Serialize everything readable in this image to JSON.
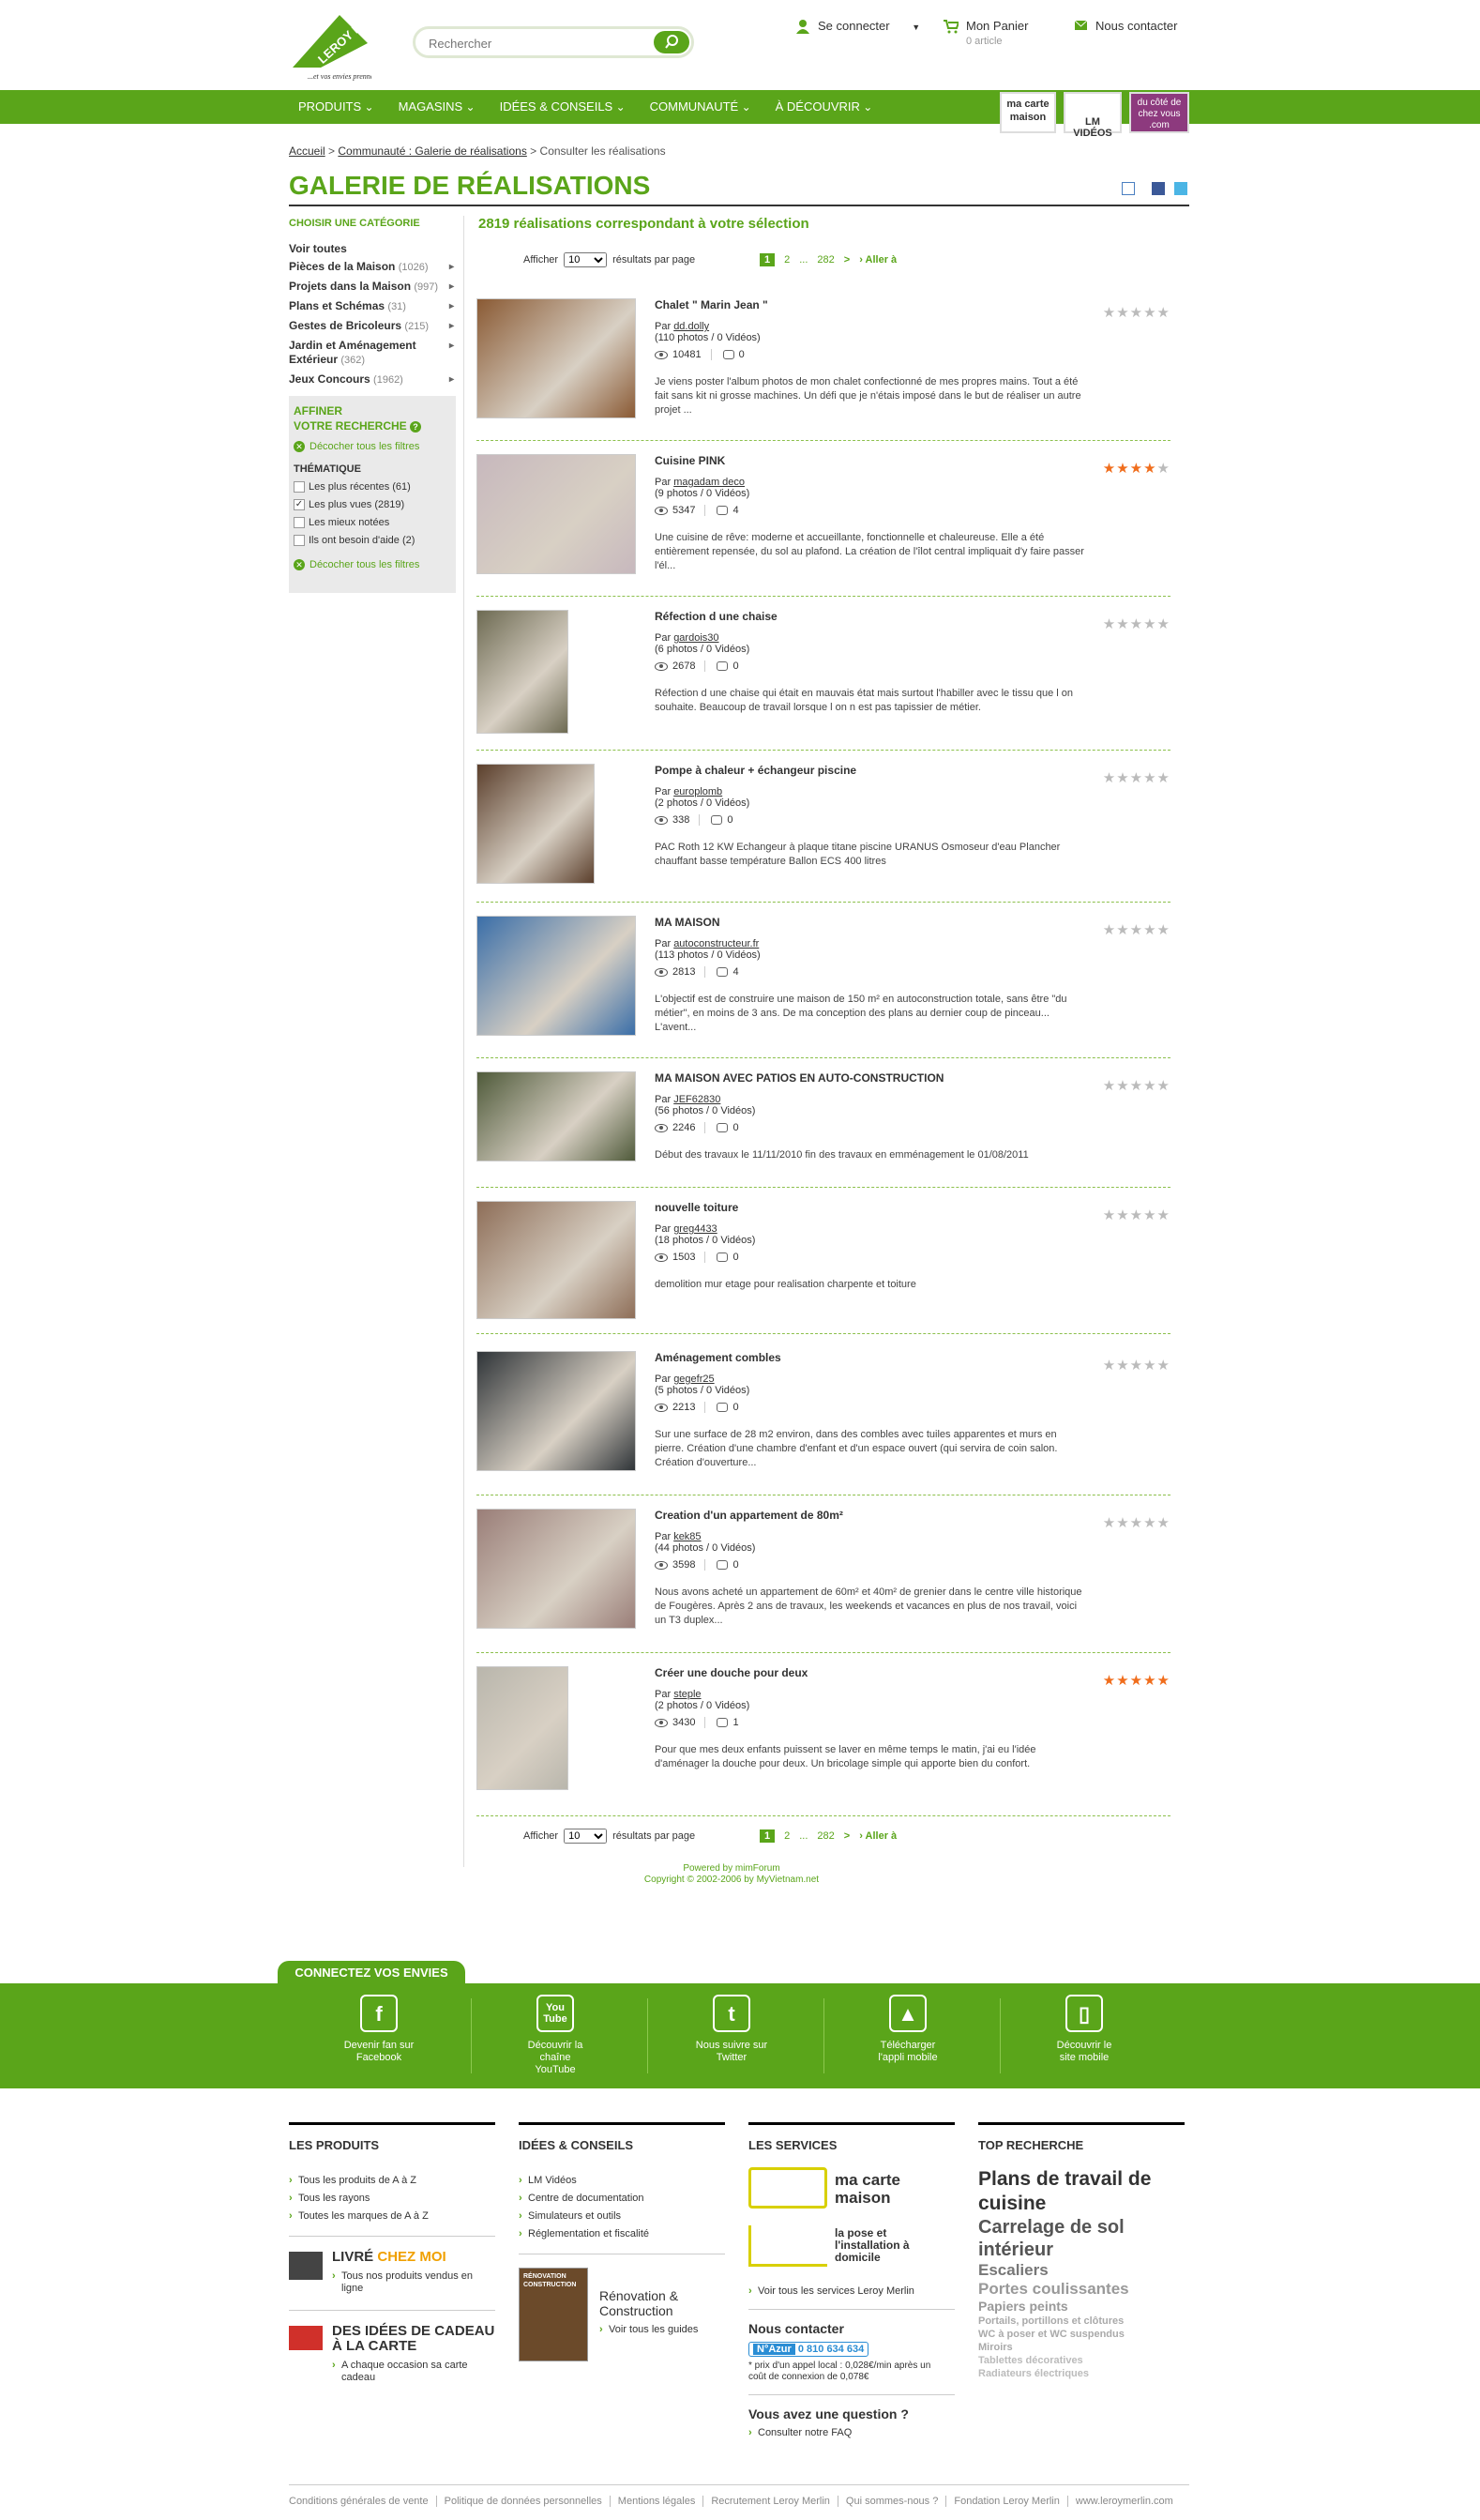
{
  "header": {
    "logo_text": "LEROY MERLIN",
    "logo_slogan": "...et vos envies prennent Vie !",
    "search_placeholder": "Rechercher",
    "login": "Se connecter",
    "cart": "Mon Panier",
    "cart_count": "0 article",
    "contact": "Nous contacter"
  },
  "nav": {
    "items": [
      "PRODUITS",
      "MAGASINS",
      "IDÉES & CONSEILS",
      "COMMUNAUTÉ",
      "À DÉCOUVRIR"
    ],
    "badges": [
      "ma carte maison",
      "LM VIDÉOS",
      "du côté de chez vous .com"
    ]
  },
  "breadcrumb": {
    "home": "Accueil",
    "section": "Communauté : Galerie de réalisations",
    "current": "Consulter les réalisations",
    "sep": ">"
  },
  "page_title": "GALERIE DE RÉALISATIONS",
  "sidebar": {
    "heading": "CHOISIR UNE CATÉGORIE",
    "all": "Voir toutes",
    "categories": [
      {
        "label": "Pièces de la Maison",
        "count": "(1026)"
      },
      {
        "label": "Projets dans la Maison",
        "count": "(997)"
      },
      {
        "label": "Plans et Schémas",
        "count": "(31)"
      },
      {
        "label": "Gestes de Bricoleurs",
        "count": "(215)"
      },
      {
        "label": "Jardin et Aménagement Extérieur",
        "count": "(362)"
      },
      {
        "label": "Jeux Concours",
        "count": "(1962)"
      }
    ],
    "refine_title_1": "AFFINER",
    "refine_title_2": "VOTRE RECHERCHE",
    "uncheck_all": "Décocher tous les filtres",
    "thematique": "THÉMATIQUE",
    "filters": [
      {
        "label": "Les plus récentes (61)",
        "checked": false
      },
      {
        "label": "Les plus vues (2819)",
        "checked": true
      },
      {
        "label": "Les mieux notées",
        "checked": false
      },
      {
        "label": "Ils ont besoin d'aide (2)",
        "checked": false
      }
    ]
  },
  "results": {
    "count_text": "2819 réalisations correspondant à votre sélection",
    "show_label": "Afficher",
    "per_page": "10",
    "per_page_suffix": "résultats par page",
    "pages": [
      "1",
      "2",
      "...",
      "282"
    ],
    "next": ">",
    "goto": "› Aller à"
  },
  "items": [
    {
      "title": "Chalet \" Marin Jean \"",
      "by": "Par",
      "author": "dd.dolly",
      "photos": "(110 photos / 0 Vidéos)",
      "views": "10481",
      "comments": "0",
      "rating": 0,
      "desc": "Je viens poster l'album photos de mon chalet confectionné de mes propres mains. Tout a été fait sans kit ni grosse machines. Un défi que je n'étais imposé dans le but de réaliser un autre projet ..."
    },
    {
      "title": "Cuisine PINK",
      "by": "Par",
      "author": "magadam deco",
      "photos": "(9 photos / 0 Vidéos)",
      "views": "5347",
      "comments": "4",
      "rating": 3.5,
      "desc": "Une cuisine de rêve: moderne et accueillante, fonctionnelle et chaleureuse. Elle a été entièrement repensée, du sol au plafond. La création de l'îlot central impliquait d'y faire passer l'él..."
    },
    {
      "title": "Réfection d une chaise",
      "by": "Par",
      "author": "gardois30",
      "photos": "(6 photos / 0 Vidéos)",
      "views": "2678",
      "comments": "0",
      "rating": 0,
      "desc": "Réfection d une chaise qui était en mauvais état mais surtout l'habiller avec le tissu que l on souhaite. Beaucoup de travail lorsque l on n est pas tapissier de métier."
    },
    {
      "title": "Pompe à chaleur + échangeur piscine",
      "by": "Par",
      "author": "europlomb",
      "photos": "(2 photos / 0 Vidéos)",
      "views": "338",
      "comments": "0",
      "rating": 0,
      "desc": "PAC Roth 12 KW Echangeur à plaque titane piscine URANUS Osmoseur d'eau Plancher chauffant basse température Ballon ECS 400 litres"
    },
    {
      "title": "MA MAISON",
      "by": "Par",
      "author": "autoconstructeur.fr",
      "photos": "(113 photos / 0 Vidéos)",
      "views": "2813",
      "comments": "4",
      "rating": 0,
      "desc": "L'objectif est de construire une maison de 150 m² en autoconstruction totale, sans être \"du métier\", en moins de 3 ans. De ma conception des plans au dernier coup de pinceau... L'avent..."
    },
    {
      "title": "MA MAISON AVEC PATIOS EN AUTO-CONSTRUCTION",
      "by": "Par",
      "author": "JEF62830",
      "photos": "(56 photos / 0 Vidéos)",
      "views": "2246",
      "comments": "0",
      "rating": 0,
      "desc": "Début des travaux le 11/11/2010 fin des travaux en emménagement le 01/08/2011"
    },
    {
      "title": "nouvelle toiture",
      "by": "Par",
      "author": "greg4433",
      "photos": "(18 photos / 0 Vidéos)",
      "views": "1503",
      "comments": "0",
      "rating": 0,
      "desc": "demolition mur etage pour realisation charpente et toiture"
    },
    {
      "title": "Aménagement combles",
      "by": "Par",
      "author": "gegefr25",
      "photos": "(5 photos / 0 Vidéos)",
      "views": "2213",
      "comments": "0",
      "rating": 0,
      "desc": "Sur une surface de 28 m2 environ, dans des combles avec tuiles apparentes et murs en pierre. Création d'une chambre d'enfant et d'un espace ouvert (qui servira de coin salon. Création d'ouverture..."
    },
    {
      "title": "Creation d'un appartement de 80m²",
      "by": "Par",
      "author": "kek85",
      "photos": "(44 photos / 0 Vidéos)",
      "views": "3598",
      "comments": "0",
      "rating": 0,
      "desc": "Nous avons acheté un appartement de 60m² et 40m² de grenier dans le centre ville historique de Fougères. Après 2 ans de travaux, les weekends et vacances en plus de nos travail, voici un T3 duplex..."
    },
    {
      "title": "Créer une douche pour deux",
      "by": "Par",
      "author": "steple",
      "photos": "(2 photos / 0 Vidéos)",
      "views": "3430",
      "comments": "1",
      "rating": 5,
      "desc": "Pour que mes deux enfants puissent se laver en même temps le matin, j'ai eu l'idée d'aménager la douche pour deux. Un bricolage simple qui apporte bien du confort."
    }
  ],
  "powered": {
    "line1": "Powered by mimForum",
    "line2": "Copyright © 2002-2006 by MyVietnam.net"
  },
  "connect": {
    "title": "CONNECTEZ VOS ENVIES",
    "items": [
      {
        "icon": "facebook-icon",
        "glyph": "f",
        "l1": "Devenir fan sur",
        "l2": "Facebook",
        "l3": ""
      },
      {
        "icon": "youtube-icon",
        "glyph": "You Tube",
        "l1": "Découvrir la",
        "l2": "chaîne",
        "l3": "YouTube"
      },
      {
        "icon": "twitter-icon",
        "glyph": "t",
        "l1": "Nous suivre sur",
        "l2": "Twitter",
        "l3": ""
      },
      {
        "icon": "app-icon",
        "glyph": "▲",
        "l1": "Télécharger",
        "l2": "l'appli mobile",
        "l3": ""
      },
      {
        "icon": "mobile-icon",
        "glyph": "▯",
        "l1": "Découvrir le",
        "l2": "site mobile",
        "l3": ""
      }
    ]
  },
  "footer": {
    "produits": {
      "title": "LES PRODUITS",
      "links": [
        "Tous les produits de A à Z",
        "Tous les rayons",
        "Toutes les marques de A à Z"
      ],
      "livre_1": "LIVRÉ",
      "livre_2": "CHEZ MOI",
      "livre_link": "Tous nos produits vendus en ligne",
      "cadeau": "DES IDÉES DE CADEAU À LA CARTE",
      "cadeau_link": "A chaque occasion sa carte cadeau"
    },
    "idees": {
      "title": "IDÉES & CONSEILS",
      "links": [
        "LM Vidéos",
        "Centre de documentation",
        "Simulateurs et outils",
        "Réglementation et fiscalité"
      ],
      "reno": "Rénovation & Construction",
      "reno_link": "Voir tous les guides",
      "book_label": "RÉNOVATION CONSTRUCTION"
    },
    "services": {
      "title": "LES SERVICES",
      "carte": "ma carte maison",
      "pose": "la pose et l'installation à domicile",
      "all": "Voir tous les services Leroy Merlin",
      "contact": "Nous contacter",
      "azur_label": "N°Azur",
      "azur": "0 810 634 634",
      "price": "* prix d'un appel local : 0,028€/min après un coût de connexion de 0,078€",
      "question": "Vous avez une question ?",
      "faq": "Consulter notre FAQ"
    },
    "top": {
      "title": "TOP RECHERCHE",
      "t1": "Plans de travail de cuisine",
      "t2": "Carrelage de sol intérieur",
      "t3": "Escaliers",
      "t4": "Portes coulissantes",
      "t5": "Papiers peints",
      "t6": "Portails, portillons et clôtures",
      "t7": "WC à poser et WC suspendus",
      "t8": "Miroirs",
      "t9": "Tablettes décoratives",
      "t10": "Radiateurs électriques"
    },
    "legal": [
      "Conditions générales de vente",
      "Politique de données personnelles",
      "Mentions légales",
      "Recrutement Leroy Merlin",
      "Qui sommes-nous ?",
      "Fondation Leroy Merlin",
      "www.leroymerlin.com"
    ]
  }
}
